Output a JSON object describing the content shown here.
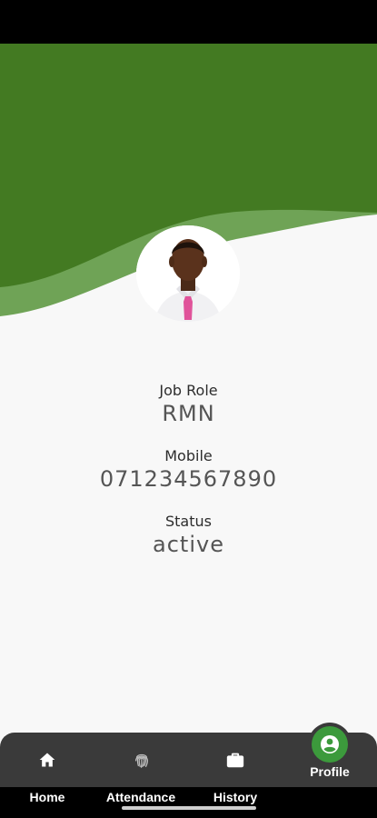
{
  "colors": {
    "header_dark": "#437a22",
    "header_light": "#6fa356",
    "accent": "#3c9a3c",
    "nav_bg": "#3a3a3a"
  },
  "profile": {
    "avatar_icon": "person-photo",
    "fields": [
      {
        "label": "Job Role",
        "value": "RMN"
      },
      {
        "label": "Mobile",
        "value": "071234567890"
      },
      {
        "label": "Status",
        "value": "active"
      }
    ]
  },
  "nav": {
    "items": [
      {
        "label": "Home",
        "icon": "home-icon"
      },
      {
        "label": "Attendance",
        "icon": "fingerprint-icon"
      },
      {
        "label": "History",
        "icon": "briefcase-icon"
      },
      {
        "label": "Profile",
        "icon": "account-circle-icon",
        "active": true
      }
    ]
  }
}
